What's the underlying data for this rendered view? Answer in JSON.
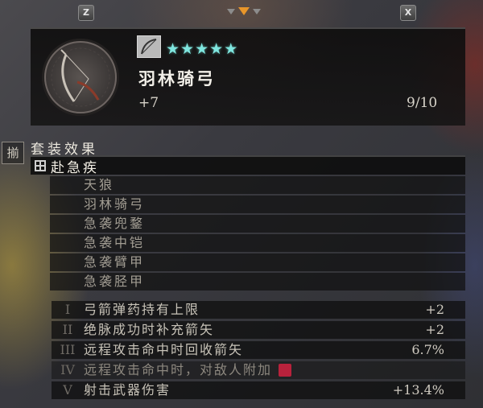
{
  "top_bar": {
    "left_key": "Z",
    "right_key": "X",
    "page_indicator": {
      "count": 3,
      "active_index": 1
    }
  },
  "item": {
    "name": "羽林骑弓",
    "level": "+7",
    "durability": "9/10",
    "stars": [
      "★",
      "★",
      "★",
      "★",
      "★"
    ],
    "type_icon": "bow-icon",
    "emblem_icon": "bow-emblem-icon"
  },
  "set": {
    "side_icon_glyph": "揃",
    "title": "套装效果",
    "name": "赴急疾",
    "pieces": [
      {
        "label": "天狼"
      },
      {
        "label": "羽林骑弓"
      },
      {
        "label": "急袭兜鍪"
      },
      {
        "label": "急袭中铠"
      },
      {
        "label": "急袭臂甲"
      },
      {
        "label": "急袭胫甲"
      }
    ]
  },
  "bonuses": [
    {
      "numeral": "I",
      "text": "弓箭弹药持有上限",
      "value": "+2",
      "dim": false,
      "has_chip": false
    },
    {
      "numeral": "II",
      "text": "绝脉成功时补充箭矢",
      "value": "+2",
      "dim": false,
      "has_chip": false
    },
    {
      "numeral": "III",
      "text": "远程攻击命中时回收箭矢",
      "value": "6.7%",
      "dim": false,
      "has_chip": false
    },
    {
      "numeral": "IV",
      "text": "远程攻击命中时，对敌人附加",
      "value": "",
      "dim": true,
      "has_chip": true
    },
    {
      "numeral": "V",
      "text": "射击武器伤害",
      "value": "+13.4%",
      "dim": false,
      "has_chip": false
    }
  ],
  "colors": {
    "star": "#7fe6df",
    "active_tab": "#e8962a",
    "status_chip": "#b8223c"
  }
}
